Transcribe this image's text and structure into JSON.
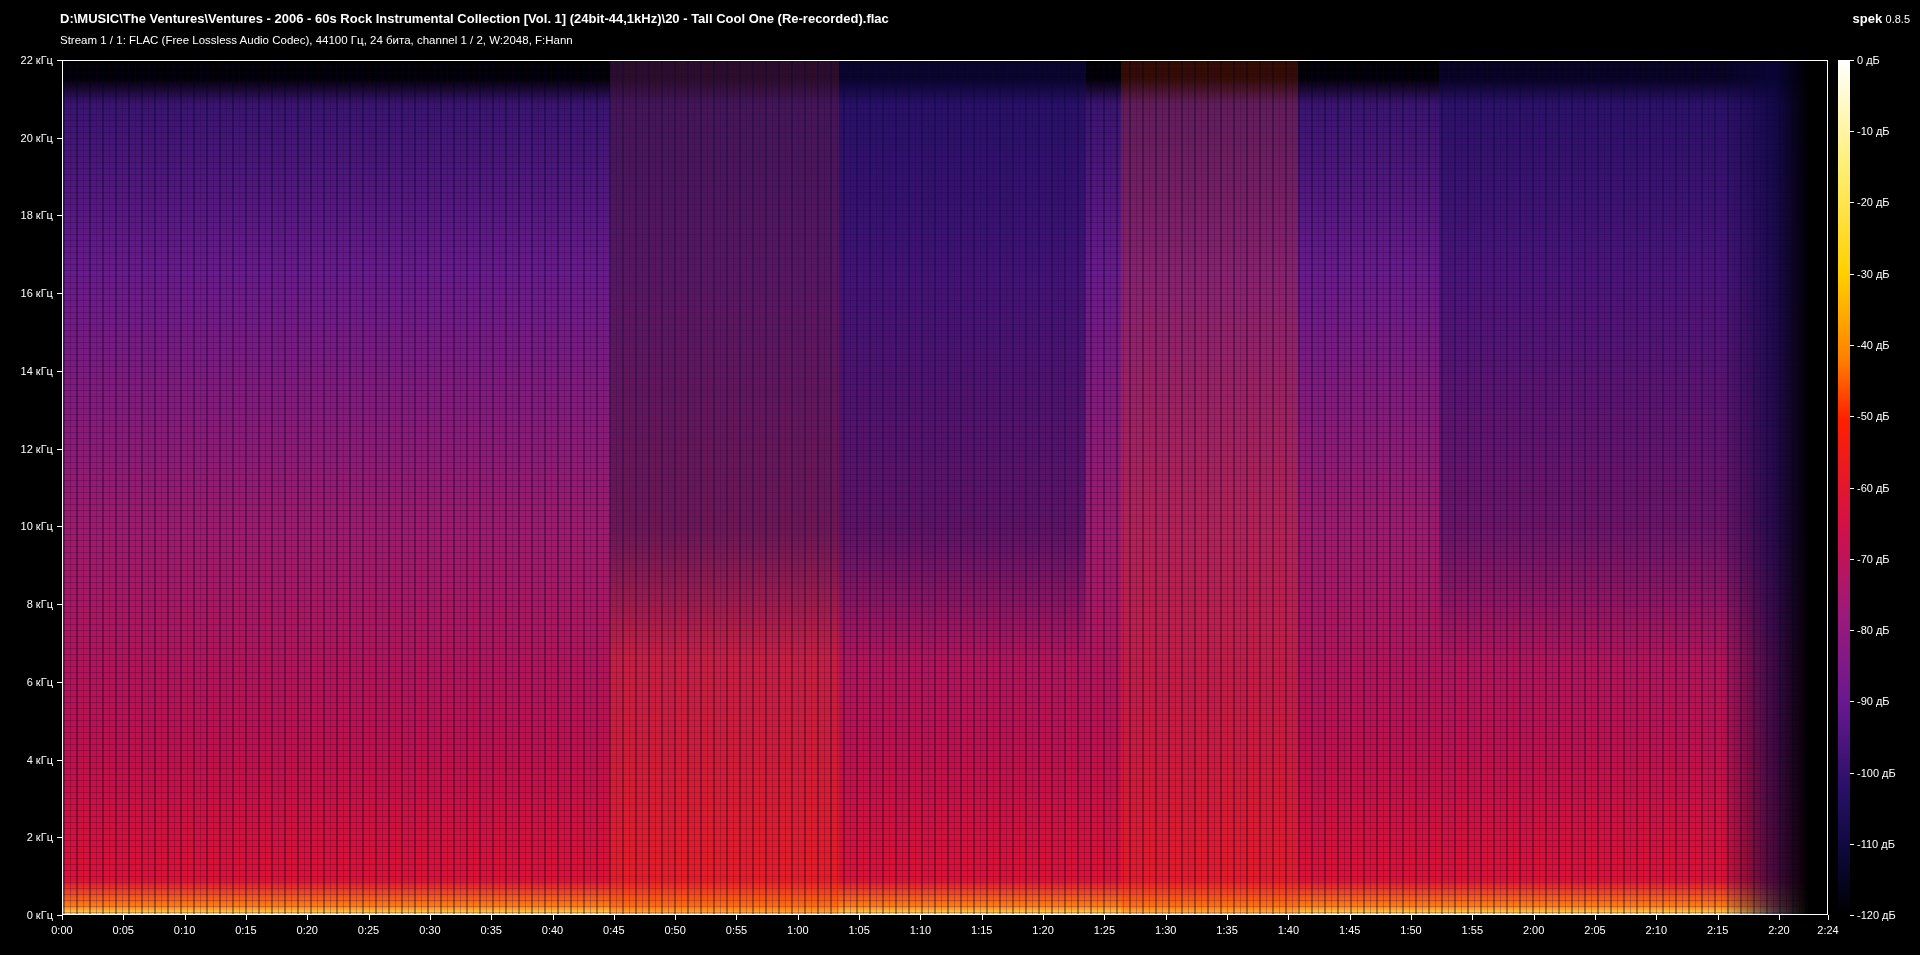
{
  "header": {
    "title": "D:\\MUSIC\\The Ventures\\Ventures - 2006 - 60s Rock Instrumental Collection [Vol. 1] (24bit-44,1kHz)\\20 - Tall Cool One (Re-recorded).flac",
    "app_name": "spek",
    "version": "0.8.5",
    "stream_info": "Stream 1 / 1: FLAC (Free Lossless Audio Codec), 44100 Гц, 24 бита, channel 1 / 2, W:2048, F:Hann"
  },
  "spectrogram": {
    "frequency_labels": [
      "22 кГц",
      "20 кГц",
      "18 кГц",
      "16 кГц",
      "14 кГц",
      "12 кГц",
      "10 кГц",
      "8 кГц",
      "6 кГц",
      "4 кГц",
      "2 кГц",
      "0 кГц"
    ],
    "time_labels": [
      "0:00",
      "0:05",
      "0:10",
      "0:15",
      "0:20",
      "0:25",
      "0:30",
      "0:35",
      "0:40",
      "0:45",
      "0:50",
      "0:55",
      "1:00",
      "1:05",
      "1:10",
      "1:15",
      "1:20",
      "1:25",
      "1:30",
      "1:35",
      "1:40",
      "1:45",
      "1:50",
      "1:55",
      "2:00",
      "2:05",
      "2:10",
      "2:15",
      "2:20",
      "2:24"
    ],
    "level_labels": [
      "0 дБ",
      "-10 дБ",
      "-20 дБ",
      "-30 дБ",
      "-40 дБ",
      "-50 дБ",
      "-60 дБ",
      "-70 дБ",
      "-80 дБ",
      "-90 дБ",
      "-100 дБ",
      "-110 дБ",
      "-120 дБ"
    ]
  }
}
